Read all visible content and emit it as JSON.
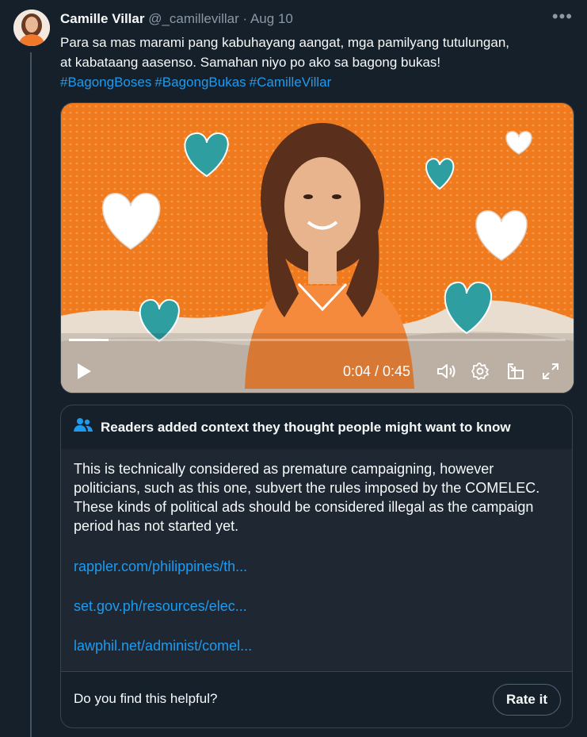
{
  "tweet": {
    "display_name": "Camille Villar",
    "handle": "@_camillevillar",
    "separator": "·",
    "date": "Aug 10",
    "more_icon": "more-horizontal-icon",
    "text_line1": "Para sa mas marami pang kabuhayang aangat, mga pamilyang tutulungan,",
    "text_line2": "at kabataang aasenso. Samahan niyo po ako sa bagong bukas!",
    "hashtags": [
      "#BagongBoses",
      "#BagongBukas",
      "#CamilleVillar"
    ]
  },
  "video": {
    "current_time": "0:04",
    "duration": "0:45",
    "time_display": "0:04 / 0:45",
    "progress": 0.08,
    "colors": {
      "background": "#f07a1e",
      "accent": "#2e9ea0"
    },
    "icons": [
      "play-icon",
      "volume-icon",
      "settings-icon",
      "pop-out-icon",
      "fullscreen-icon"
    ]
  },
  "community_note": {
    "header_icon": "people-icon",
    "header": "Readers added context they thought people might want to know",
    "body": "This is technically considered as premature campaigning, however politicians, such as this one, subvert the rules imposed by the COMELEC. These kinds of political ads should be considered illegal as the campaign period has not started yet.",
    "links": [
      "rappler.com/philippines/th...",
      "set.gov.ph/resources/elec...",
      "lawphil.net/administ/comel..."
    ],
    "helpful_prompt": "Do you find this helpful?",
    "rate_label": "Rate it"
  },
  "colors": {
    "background": "#15202b",
    "link": "#1d9bf0",
    "muted": "#8b98a5"
  }
}
